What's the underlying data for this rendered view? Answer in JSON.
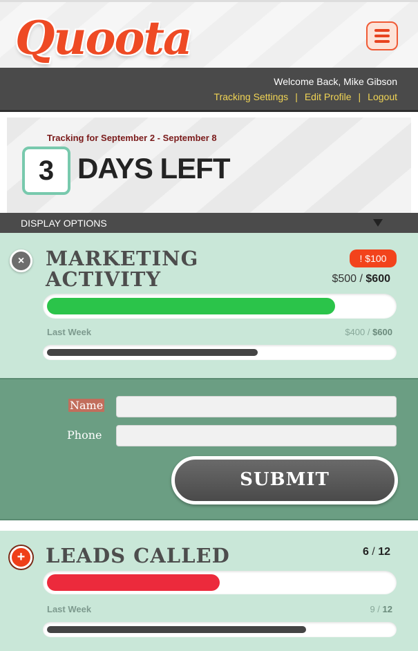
{
  "header": {
    "logo_text": "Quoota",
    "welcome": "Welcome Back, Mike Gibson",
    "links": [
      "Tracking Settings",
      "Edit Profile",
      "Logout"
    ],
    "separator": "|"
  },
  "tracking": {
    "period": "Tracking for September 2 - September 8",
    "days_number": "3",
    "days_label": "DAYS LEFT"
  },
  "display_options": {
    "label": "DISPLAY OPTIONS"
  },
  "marketing": {
    "title_line1": "MARKETING",
    "title_line2": "ACTIVITY",
    "badge": "! $100",
    "current": "$500",
    "slash": " / ",
    "goal": "$600",
    "progress_fraction": 0.833,
    "last_week_label": "Last Week",
    "last_week_current": "$400",
    "last_week_goal": "$600",
    "last_week_fraction": 0.667,
    "close_icon": "×"
  },
  "form": {
    "name_label": "Name",
    "phone_label": "Phone",
    "name_value": "",
    "phone_value": "",
    "submit_label": "SUBMIT"
  },
  "leads": {
    "title": "LEADS CALLED",
    "current": "6",
    "slash": " / ",
    "goal": "12",
    "progress_fraction": 0.5,
    "last_week_label": "Last Week",
    "last_week_current": "9",
    "last_week_goal": "12",
    "last_week_fraction": 0.75,
    "add_icon": "+"
  },
  "colors": {
    "brand": "#ee4a24",
    "progress_good": "#2bc44a",
    "progress_bad": "#ec2a3c",
    "last_week_bar": "#444444",
    "card_bg": "#c9e7d8",
    "form_bg": "#6b9e83"
  }
}
